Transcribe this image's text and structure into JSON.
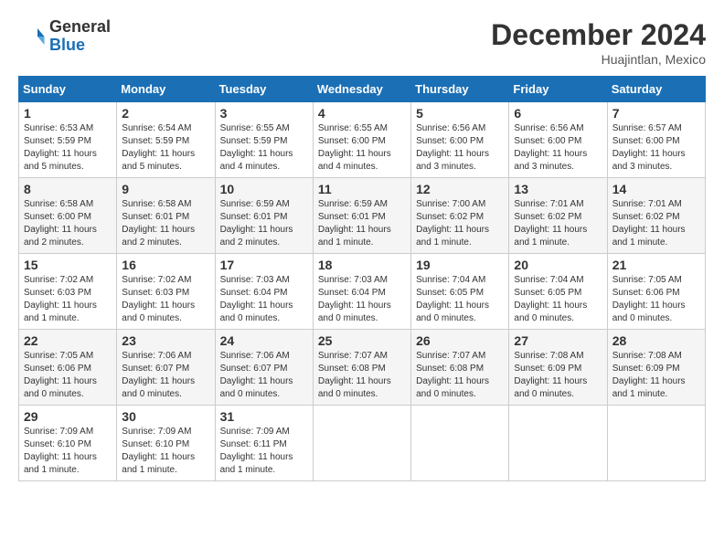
{
  "header": {
    "logo_line1": "General",
    "logo_line2": "Blue",
    "month": "December 2024",
    "location": "Huajintlan, Mexico"
  },
  "days_of_week": [
    "Sunday",
    "Monday",
    "Tuesday",
    "Wednesday",
    "Thursday",
    "Friday",
    "Saturday"
  ],
  "weeks": [
    [
      {
        "day": "1",
        "info": "Sunrise: 6:53 AM\nSunset: 5:59 PM\nDaylight: 11 hours and 5 minutes."
      },
      {
        "day": "2",
        "info": "Sunrise: 6:54 AM\nSunset: 5:59 PM\nDaylight: 11 hours and 5 minutes."
      },
      {
        "day": "3",
        "info": "Sunrise: 6:55 AM\nSunset: 5:59 PM\nDaylight: 11 hours and 4 minutes."
      },
      {
        "day": "4",
        "info": "Sunrise: 6:55 AM\nSunset: 6:00 PM\nDaylight: 11 hours and 4 minutes."
      },
      {
        "day": "5",
        "info": "Sunrise: 6:56 AM\nSunset: 6:00 PM\nDaylight: 11 hours and 3 minutes."
      },
      {
        "day": "6",
        "info": "Sunrise: 6:56 AM\nSunset: 6:00 PM\nDaylight: 11 hours and 3 minutes."
      },
      {
        "day": "7",
        "info": "Sunrise: 6:57 AM\nSunset: 6:00 PM\nDaylight: 11 hours and 3 minutes."
      }
    ],
    [
      {
        "day": "8",
        "info": "Sunrise: 6:58 AM\nSunset: 6:00 PM\nDaylight: 11 hours and 2 minutes."
      },
      {
        "day": "9",
        "info": "Sunrise: 6:58 AM\nSunset: 6:01 PM\nDaylight: 11 hours and 2 minutes."
      },
      {
        "day": "10",
        "info": "Sunrise: 6:59 AM\nSunset: 6:01 PM\nDaylight: 11 hours and 2 minutes."
      },
      {
        "day": "11",
        "info": "Sunrise: 6:59 AM\nSunset: 6:01 PM\nDaylight: 11 hours and 1 minute."
      },
      {
        "day": "12",
        "info": "Sunrise: 7:00 AM\nSunset: 6:02 PM\nDaylight: 11 hours and 1 minute."
      },
      {
        "day": "13",
        "info": "Sunrise: 7:01 AM\nSunset: 6:02 PM\nDaylight: 11 hours and 1 minute."
      },
      {
        "day": "14",
        "info": "Sunrise: 7:01 AM\nSunset: 6:02 PM\nDaylight: 11 hours and 1 minute."
      }
    ],
    [
      {
        "day": "15",
        "info": "Sunrise: 7:02 AM\nSunset: 6:03 PM\nDaylight: 11 hours and 1 minute."
      },
      {
        "day": "16",
        "info": "Sunrise: 7:02 AM\nSunset: 6:03 PM\nDaylight: 11 hours and 0 minutes."
      },
      {
        "day": "17",
        "info": "Sunrise: 7:03 AM\nSunset: 6:04 PM\nDaylight: 11 hours and 0 minutes."
      },
      {
        "day": "18",
        "info": "Sunrise: 7:03 AM\nSunset: 6:04 PM\nDaylight: 11 hours and 0 minutes."
      },
      {
        "day": "19",
        "info": "Sunrise: 7:04 AM\nSunset: 6:05 PM\nDaylight: 11 hours and 0 minutes."
      },
      {
        "day": "20",
        "info": "Sunrise: 7:04 AM\nSunset: 6:05 PM\nDaylight: 11 hours and 0 minutes."
      },
      {
        "day": "21",
        "info": "Sunrise: 7:05 AM\nSunset: 6:06 PM\nDaylight: 11 hours and 0 minutes."
      }
    ],
    [
      {
        "day": "22",
        "info": "Sunrise: 7:05 AM\nSunset: 6:06 PM\nDaylight: 11 hours and 0 minutes."
      },
      {
        "day": "23",
        "info": "Sunrise: 7:06 AM\nSunset: 6:07 PM\nDaylight: 11 hours and 0 minutes."
      },
      {
        "day": "24",
        "info": "Sunrise: 7:06 AM\nSunset: 6:07 PM\nDaylight: 11 hours and 0 minutes."
      },
      {
        "day": "25",
        "info": "Sunrise: 7:07 AM\nSunset: 6:08 PM\nDaylight: 11 hours and 0 minutes."
      },
      {
        "day": "26",
        "info": "Sunrise: 7:07 AM\nSunset: 6:08 PM\nDaylight: 11 hours and 0 minutes."
      },
      {
        "day": "27",
        "info": "Sunrise: 7:08 AM\nSunset: 6:09 PM\nDaylight: 11 hours and 0 minutes."
      },
      {
        "day": "28",
        "info": "Sunrise: 7:08 AM\nSunset: 6:09 PM\nDaylight: 11 hours and 1 minute."
      }
    ],
    [
      {
        "day": "29",
        "info": "Sunrise: 7:09 AM\nSunset: 6:10 PM\nDaylight: 11 hours and 1 minute."
      },
      {
        "day": "30",
        "info": "Sunrise: 7:09 AM\nSunset: 6:10 PM\nDaylight: 11 hours and 1 minute."
      },
      {
        "day": "31",
        "info": "Sunrise: 7:09 AM\nSunset: 6:11 PM\nDaylight: 11 hours and 1 minute."
      },
      null,
      null,
      null,
      null
    ]
  ]
}
